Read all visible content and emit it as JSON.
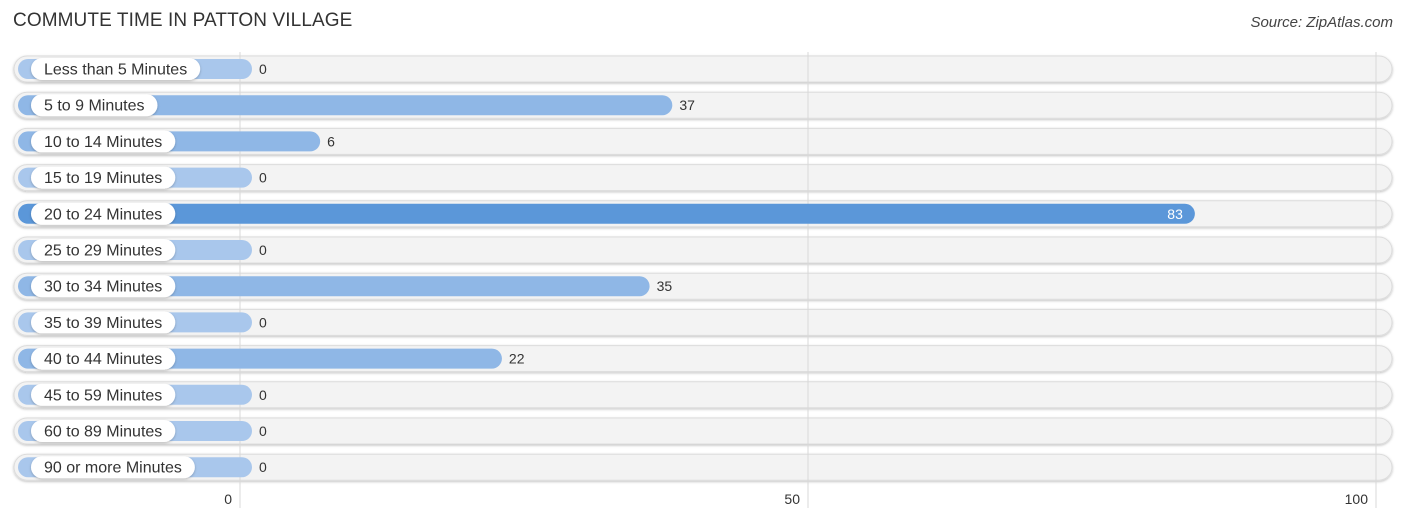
{
  "title": "COMMUTE TIME IN PATTON VILLAGE",
  "source": "Source: ZipAtlas.com",
  "colors": {
    "bar": "#8fb7e6",
    "bar_highlight": "#5b97d9",
    "bar_zero": "#a9c7ec",
    "track": "#f3f3f3"
  },
  "chart_data": {
    "type": "bar",
    "orientation": "horizontal",
    "title": "COMMUTE TIME IN PATTON VILLAGE",
    "xlabel": "",
    "ylabel": "",
    "categories": [
      "Less than 5 Minutes",
      "5 to 9 Minutes",
      "10 to 14 Minutes",
      "15 to 19 Minutes",
      "20 to 24 Minutes",
      "25 to 29 Minutes",
      "30 to 34 Minutes",
      "35 to 39 Minutes",
      "40 to 44 Minutes",
      "45 to 59 Minutes",
      "60 to 89 Minutes",
      "90 or more Minutes"
    ],
    "values": [
      0,
      37,
      6,
      0,
      83,
      0,
      35,
      0,
      22,
      0,
      0,
      0
    ],
    "xlim": [
      0,
      100
    ],
    "xticks": [
      0,
      50,
      100
    ],
    "xtick_labels": [
      "0",
      "50",
      "100"
    ],
    "grid": true,
    "highlight_index": 4
  }
}
